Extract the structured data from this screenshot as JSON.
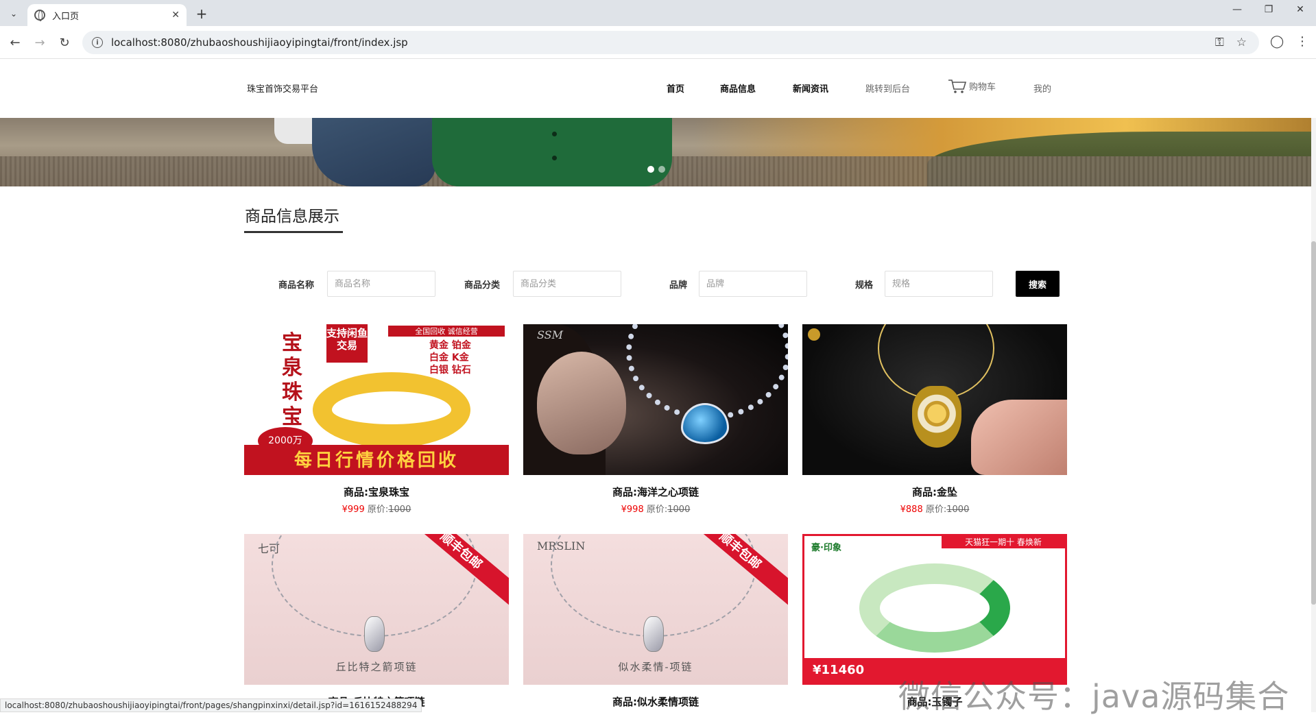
{
  "browser": {
    "tab_title": "入口页",
    "url": "localhost:8080/zhubaoshoushijiaoyipingtai/front/index.jsp",
    "status_url": "localhost:8080/zhubaoshoushijiaoyipingtai/front/pages/shangpinxinxi/detail.jsp?id=1616152488294"
  },
  "header": {
    "brand": "珠宝首饰交易平台",
    "nav": {
      "home": "首页",
      "products": "商品信息",
      "news": "新闻资讯",
      "admin": "跳转到后台",
      "cart": "购物车",
      "mine": "我的"
    }
  },
  "section": {
    "title": "商品信息展示"
  },
  "filters": {
    "name_label": "商品名称",
    "name_placeholder": "商品名称",
    "category_label": "商品分类",
    "category_placeholder": "商品分类",
    "brand_label": "品牌",
    "brand_placeholder": "品牌",
    "spec_label": "规格",
    "spec_placeholder": "规格",
    "search_label": "搜索"
  },
  "products": [
    {
      "name": "商品:宝泉珠宝",
      "price": "¥999",
      "orig_label": "原价:",
      "orig": "1000"
    },
    {
      "name": "商品:海洋之心项链",
      "price": "¥998",
      "orig_label": "原价:",
      "orig": "1000"
    },
    {
      "name": "商品:金坠",
      "price": "¥888",
      "orig_label": "原价:",
      "orig": "1000"
    },
    {
      "name": "商品:丘比特之箭项链"
    },
    {
      "name": "商品:似水柔情项链"
    },
    {
      "name": "商品:玉镯子"
    }
  ],
  "product_art": {
    "gold": {
      "vertical": "宝泉珠宝",
      "tag": "全国回收 诚信经营",
      "list": [
        "黄金 铂金",
        "白金 K金",
        "白银 钻石"
      ],
      "badge": "支持闲鱼交易",
      "circle": "2000万",
      "slogan": "每日行情价格回收"
    },
    "ocean": {
      "logo": "SSM"
    },
    "cupid": {
      "logo": "七可",
      "corner": "顺丰包邮",
      "caption": "丘比特之箭项链"
    },
    "water": {
      "logo": "MRSLIN",
      "corner": "顺丰包邮",
      "caption": "似水柔情-项链"
    },
    "jade": {
      "logo": "豪·印象",
      "top": "天猫狂一期十  春焕新",
      "bar": "¥11460"
    }
  },
  "watermark": "微信公众号：java源码集合",
  "colors": {
    "price_red": "#ee0000",
    "button_black": "#000000"
  }
}
